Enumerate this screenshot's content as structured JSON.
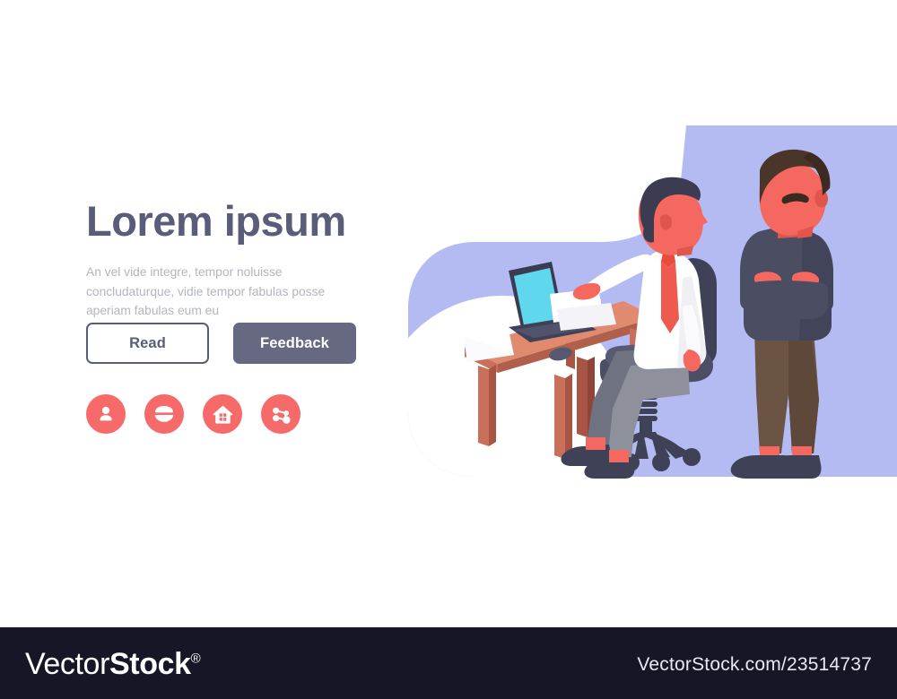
{
  "banner": {
    "title": "Lorem ipsum",
    "subtitle": "An vel vide integre, tempor noluisse concludaturque, vidie tempor fabulas posse aperiam fabulas eum eu",
    "buttons": {
      "read_label": "Read",
      "feedback_label": "Feedback"
    },
    "social_icons": [
      {
        "name": "user-icon",
        "label": "User"
      },
      {
        "name": "lens-icon",
        "label": "Lens"
      },
      {
        "name": "home-icon",
        "label": "Home"
      },
      {
        "name": "share-icon",
        "label": "Share"
      }
    ],
    "illustration": {
      "description": "Two businessmen at a desk with laptop, one seated in office chair gesturing, one standing with arms crossed",
      "elements": [
        "blue-blob-background",
        "wooden-desk",
        "laptop",
        "papers",
        "computer-mouse",
        "seated-businessman",
        "office-chair",
        "standing-businessman"
      ]
    }
  },
  "footer": {
    "brand_thin": "Vector",
    "brand_bold": "Stock",
    "brand_registered": "®",
    "url": "VectorStock.com/23514737"
  },
  "colors": {
    "heading": "#5a5d7a",
    "subtitle": "#b3b5c0",
    "accent_coral": "#f66a6a",
    "button_fill": "#666981",
    "illustration_bg": "#b3bbf2",
    "skin": "#f4685f",
    "footer_bg": "#161627",
    "laptop_screen": "#5fd8ee",
    "desk_wood": "#c9705a",
    "trousers_gray": "#8e909b",
    "trousers_brown": "#6b5444",
    "sweater_dark": "#4b4d63"
  }
}
